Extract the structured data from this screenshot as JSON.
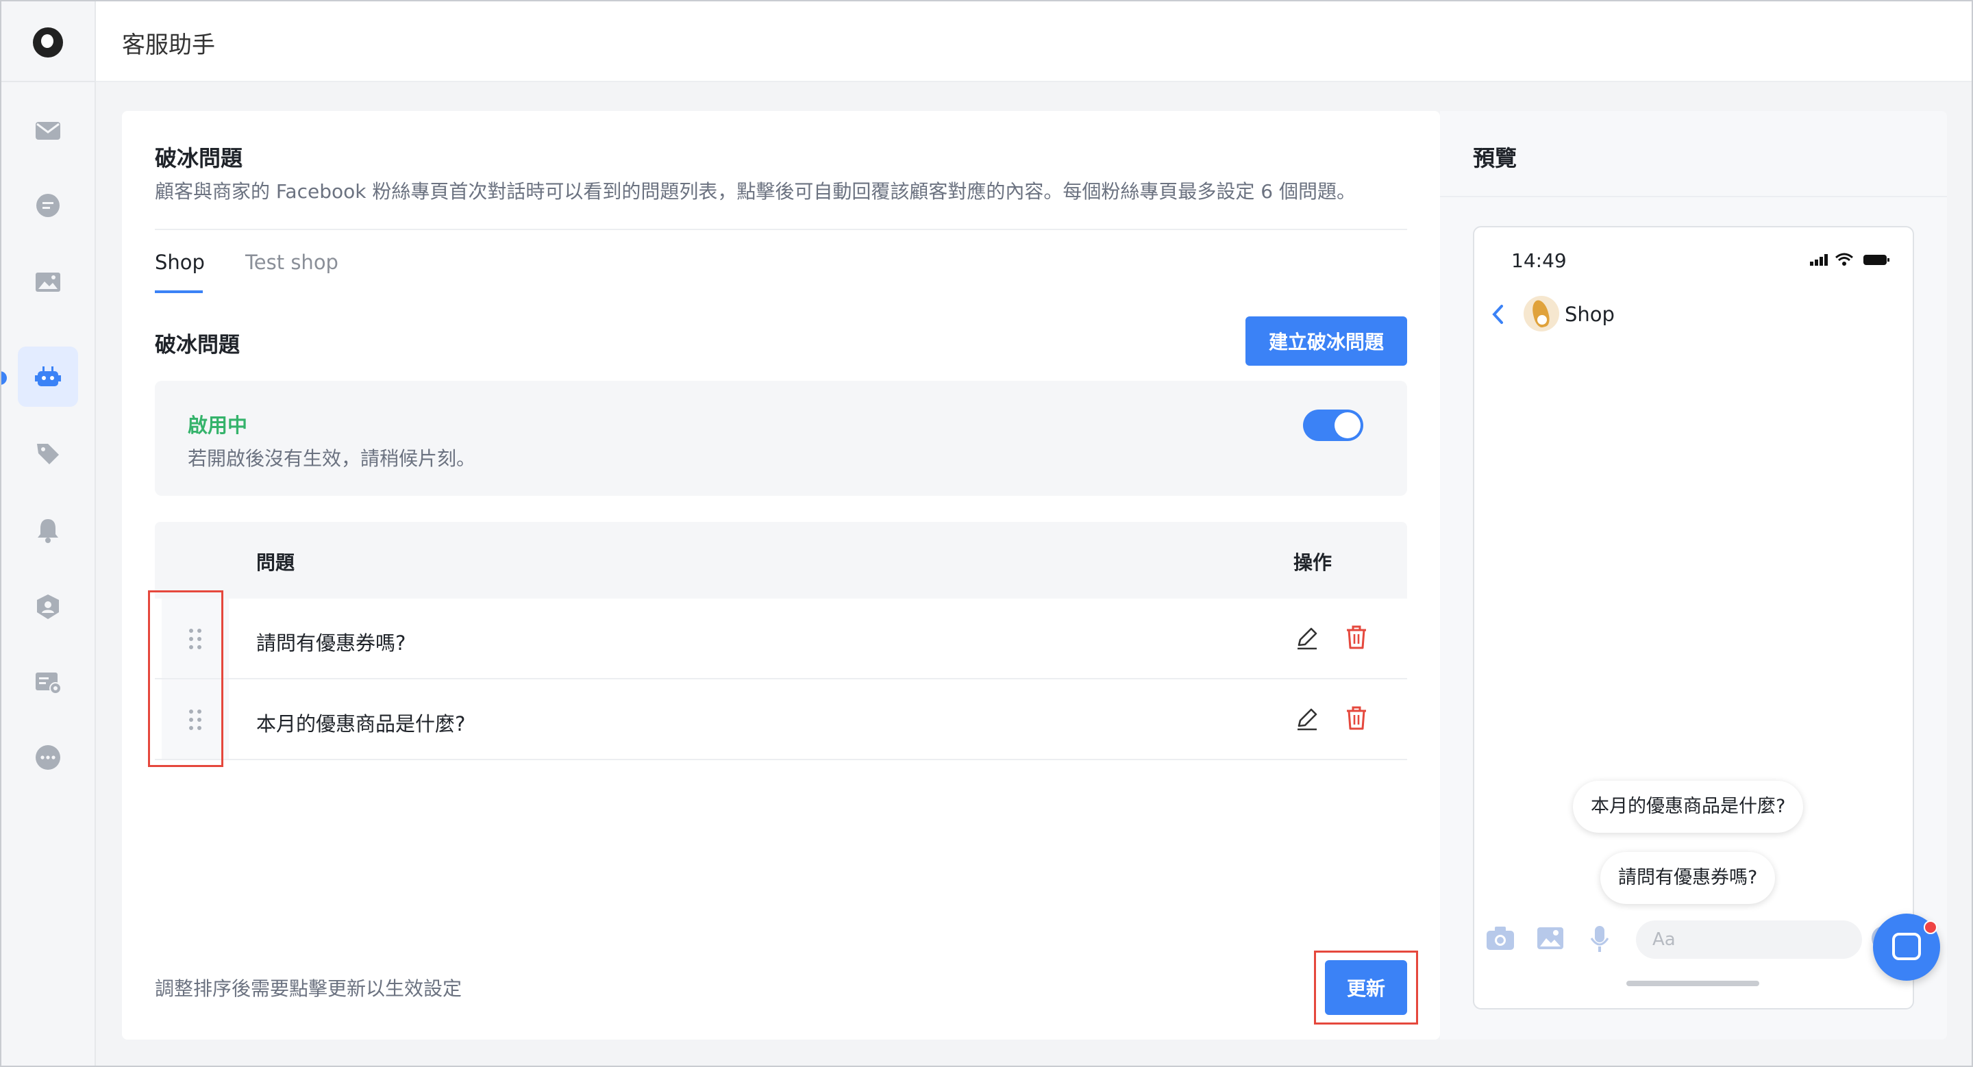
{
  "header": {
    "title": "客服助手"
  },
  "sidebar": {
    "items": [
      {
        "name": "inbox",
        "icon": "mail-icon"
      },
      {
        "name": "chat",
        "icon": "chat-icon"
      },
      {
        "name": "media",
        "icon": "image-icon"
      },
      {
        "name": "bot",
        "icon": "robot-icon",
        "active": true
      },
      {
        "name": "tags",
        "icon": "tag-icon"
      },
      {
        "name": "notifications",
        "icon": "bell-icon"
      },
      {
        "name": "users",
        "icon": "user-shield-icon"
      },
      {
        "name": "settings",
        "icon": "card-settings-icon"
      },
      {
        "name": "more",
        "icon": "more-icon"
      }
    ]
  },
  "main": {
    "title": "破冰問題",
    "description": "顧客與商家的 Facebook 粉絲專頁首次對話時可以看到的問題列表，點擊後可自動回覆該顧客對應的內容。每個粉絲專頁最多設定 6 個問題。",
    "tabs": [
      {
        "label": "Shop",
        "active": true
      },
      {
        "label": "Test shop",
        "active": false
      }
    ],
    "section_title": "破冰問題",
    "create_button": "建立破冰問題",
    "status": {
      "label": "啟用中",
      "hint": "若開啟後沒有生效，請稍候片刻。",
      "enabled": true
    },
    "table": {
      "columns": {
        "question": "問題",
        "actions": "操作"
      },
      "rows": [
        {
          "question": "請問有優惠券嗎?"
        },
        {
          "question": "本月的優惠商品是什麼?"
        }
      ]
    },
    "footer_hint": "調整排序後需要點擊更新以生效設定",
    "update_button": "更新"
  },
  "preview": {
    "title": "預覽",
    "time": "14:49",
    "page_name": "Shop",
    "chips": [
      "本月的優惠商品是什麼?",
      "請問有優惠券嗎?"
    ],
    "input_placeholder": "Aa"
  },
  "colors": {
    "accent": "#3b82f6",
    "enabled": "#35b36b",
    "delete": "#e5483d",
    "highlight": "#e5483d"
  }
}
